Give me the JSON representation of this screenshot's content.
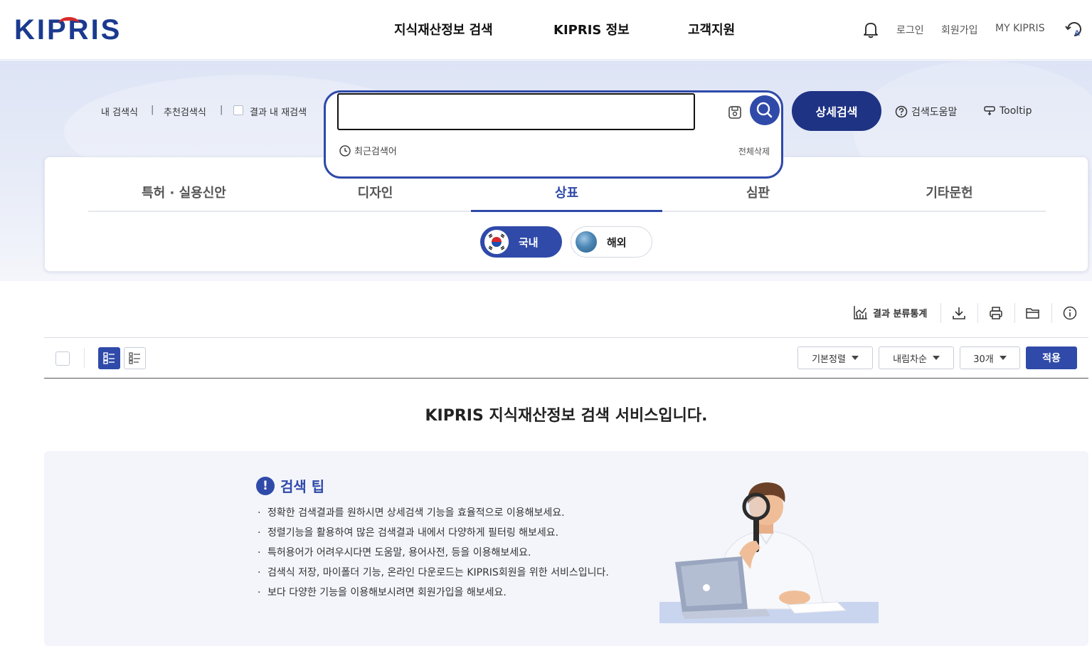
{
  "header": {
    "logo": "KIPRIS",
    "nav": [
      "지식재산정보 검색",
      "KIPRIS 정보",
      "고객지원"
    ],
    "util": {
      "login": "로그인",
      "signup": "회원가입",
      "my": "MY KIPRIS"
    }
  },
  "search": {
    "quick_links": [
      "내 검색식",
      "추천검색식"
    ],
    "within_results": "결과 내 재검색",
    "query": "",
    "placeholder": "",
    "recent_label": "최근검색어",
    "delete_all": "전체삭제",
    "detail_search": "상세검색",
    "help": "검색도움말",
    "tooltip": "Tooltip"
  },
  "tabs": {
    "items": [
      "특허 · 실용신안",
      "디자인",
      "상표",
      "심판",
      "기타문헌"
    ],
    "active": "상표",
    "region": {
      "domestic": "국내",
      "overseas": "해외"
    }
  },
  "toolbar": {
    "stats": "결과 분류통계",
    "sort": "기본정렬",
    "order": "내림차순",
    "count": "30개",
    "apply": "적용"
  },
  "welcome": "KIPRIS 지식재산정보 검색 서비스입니다.",
  "tips": {
    "title": "검색 팁",
    "items": [
      "정확한 검색결과를 원하시면 상세검색 기능을 효율적으로 이용해보세요.",
      "정렬기능을 활용하여 많은 검색결과 내에서 다양하게 필터링 해보세요.",
      "특허용어가 어려우시다면 도움말, 용어사전, 등을 이용해보세요.",
      "검색식 저장, 마이폴더 기능, 온라인 다운로드는 KIPRIS회원을 위한 서비스입니다.",
      "보다 다양한 기능을 이용해보시려면 회원가입을 해보세요."
    ]
  },
  "colors": {
    "primary": "#2f4aa9",
    "navy": "#1f3384",
    "accent_red": "#d62b2b"
  }
}
